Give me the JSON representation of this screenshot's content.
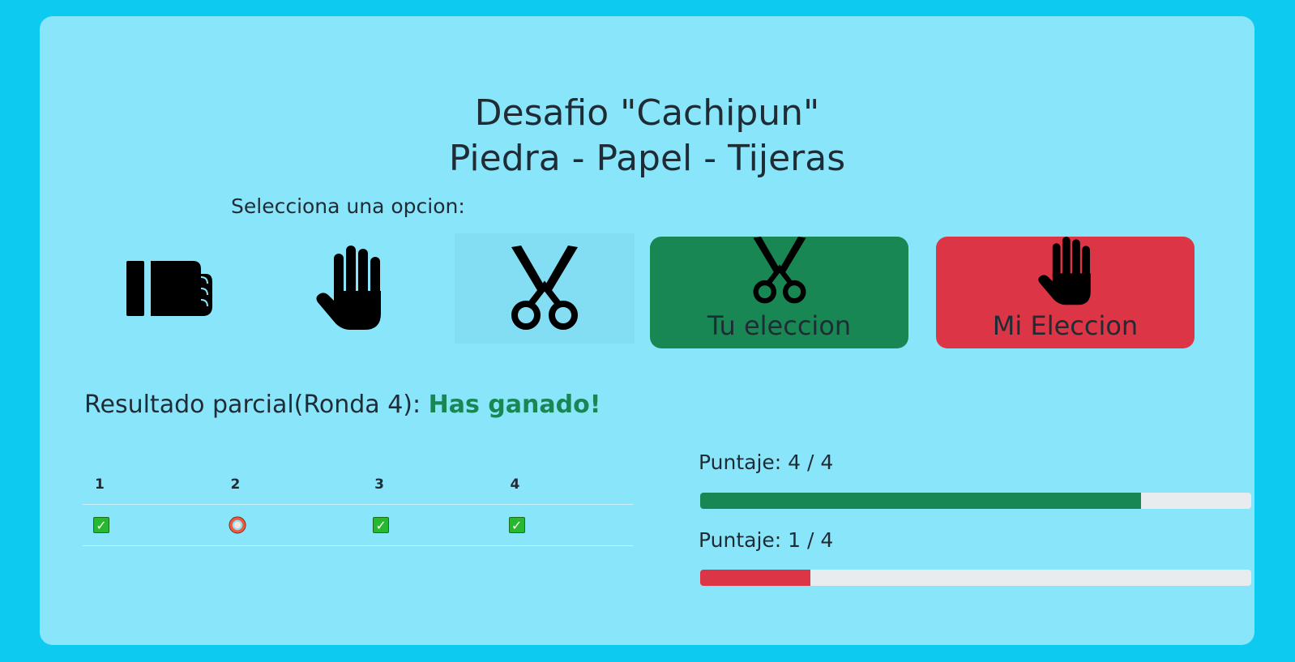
{
  "title": {
    "line1": "Desafio \"Cachipun\"",
    "line2": "Piedra - Papel - Tijeras"
  },
  "prompt": "Selecciona una opcion:",
  "options": [
    {
      "name": "piedra",
      "icon": "fist-icon",
      "selected": false
    },
    {
      "name": "papel",
      "icon": "hand-icon",
      "selected": false
    },
    {
      "name": "tijeras",
      "icon": "scissors-icon",
      "selected": true
    }
  ],
  "player_choice": {
    "label": "Tu eleccion",
    "icon": "scissors-icon",
    "color": "#198754"
  },
  "computer_choice": {
    "label": "Mi Eleccion",
    "icon": "hand-icon",
    "color": "#dc3545"
  },
  "result": {
    "prefix": "Resultado parcial(Ronda 4):",
    "status": "Has ganado!"
  },
  "rounds": {
    "headers": [
      "1",
      "2",
      "3",
      "4"
    ],
    "results": [
      "check-icon",
      "ring-icon",
      "check-icon",
      "check-icon"
    ]
  },
  "scores": [
    {
      "label": "Puntaje: 4 / 4",
      "fraction": 0.8,
      "color": "#198754"
    },
    {
      "label": "Puntaje: 1 / 4",
      "fraction": 0.2,
      "color": "#dc3545"
    }
  ]
}
